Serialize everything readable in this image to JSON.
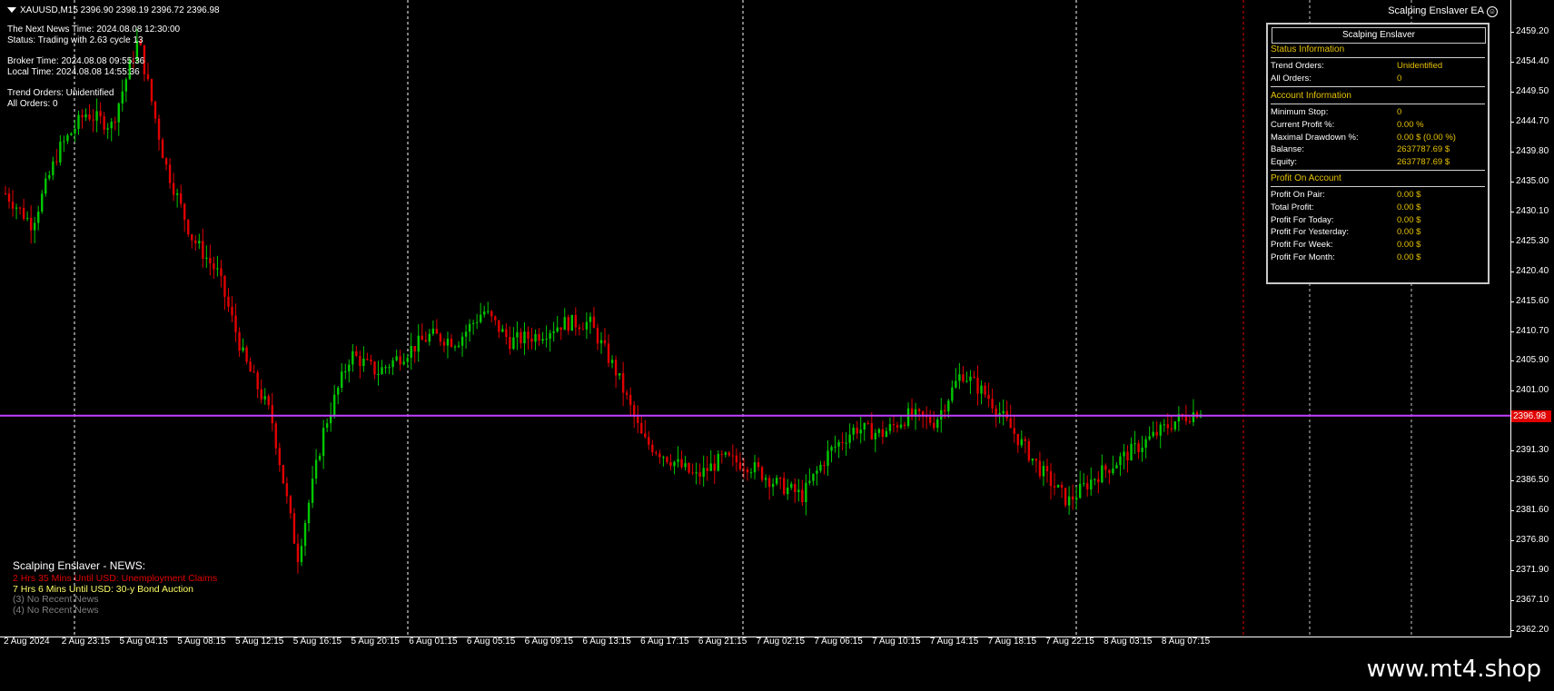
{
  "header": {
    "symbol_line": "XAUUSD,M15  2396.90 2398.19 2396.72 2396.98",
    "ea_label": "Scalping Enslaver EA"
  },
  "info_left": {
    "lines": [
      "The Next News Time: 2024.08.08 12:30:00",
      "Status: Trading with 2.63 cycle 13",
      "",
      "Broker Time: 2024.08.08 09:55:36",
      "Local Time: 2024.08.08 14:55:36",
      "",
      "Trend Orders: Unidentified",
      "All Orders: 0"
    ]
  },
  "panel": {
    "title": "Scalping Enslaver",
    "status_section": "Status Information",
    "status_rows": [
      {
        "label": "Trend Orders:",
        "value": "Unidentified"
      },
      {
        "label": "All Orders:",
        "value": "0"
      }
    ],
    "account_section": "Account Information",
    "account_rows": [
      {
        "label": "Minimum Stop:",
        "value": "0"
      },
      {
        "label": "Current Profit %:",
        "value": "0.00 %"
      },
      {
        "label": "Maximal Drawdown %:",
        "value": "0.00 $ (0.00 %)"
      },
      {
        "label": "Balanse:",
        "value": "2637787.69 $"
      },
      {
        "label": "Equity:",
        "value": "2637787.69 $"
      }
    ],
    "profit_section": "Profit On Account",
    "profit_rows": [
      {
        "label": "Profit On Pair:",
        "value": "0.00 $"
      },
      {
        "label": "Total Profit:",
        "value": "0.00 $"
      },
      {
        "label": "Profit For Today:",
        "value": "0.00 $"
      },
      {
        "label": "Profit For Yesterday:",
        "value": "0.00 $"
      },
      {
        "label": "Profit For Week:",
        "value": "0.00 $"
      },
      {
        "label": "Profit For Month:",
        "value": "0.00 $"
      }
    ]
  },
  "news": {
    "title": "Scalping Enslaver - NEWS:",
    "items": [
      {
        "text": "2 Hrs 35 Mins Until USD: Unemployment Claims",
        "color": "#e00000"
      },
      {
        "text": "7 Hrs 6 Mins Until USD: 30-y Bond Auction",
        "color": "#ffff66"
      },
      {
        "text": "(3)  No Recent News",
        "color": "#808080"
      },
      {
        "text": "(4)  No Recent News",
        "color": "#808080"
      }
    ]
  },
  "price_axis": [
    "2459.20",
    "2454.40",
    "2449.50",
    "2444.70",
    "2439.80",
    "2435.00",
    "2430.10",
    "2425.30",
    "2420.40",
    "2415.60",
    "2410.70",
    "2405.90",
    "2401.00",
    "2396.20",
    "2391.30",
    "2386.50",
    "2381.60",
    "2376.80",
    "2371.90",
    "2367.10",
    "2362.20"
  ],
  "current_price": "2396.98",
  "time_axis": [
    "2 Aug 2024",
    "2 Aug 23:15",
    "5 Aug 04:15",
    "5 Aug 08:15",
    "5 Aug 12:15",
    "5 Aug 16:15",
    "5 Aug 20:15",
    "6 Aug 01:15",
    "6 Aug 05:15",
    "6 Aug 09:15",
    "6 Aug 13:15",
    "6 Aug 17:15",
    "6 Aug 21:15",
    "7 Aug 02:15",
    "7 Aug 06:15",
    "7 Aug 10:15",
    "7 Aug 14:15",
    "7 Aug 18:15",
    "7 Aug 22:15",
    "8 Aug 03:15",
    "8 Aug 07:15"
  ],
  "watermark": "www.mt4.shop",
  "colors": {
    "bull": "#00c800",
    "bear": "#e00000",
    "price_line": "#c040ff",
    "day_separator": "#ffffff",
    "session_separator": "#e00000",
    "accent": "#e6c200"
  },
  "chart_data": {
    "type": "candlestick",
    "ylim": [
      2362.2,
      2461.0
    ],
    "anchor_closes": [
      2433,
      2428,
      2440,
      2446,
      2444,
      2458,
      2438,
      2426,
      2420,
      2406,
      2397,
      2374,
      2395,
      2407,
      2404,
      2407,
      2410,
      2409,
      2414,
      2409,
      2410,
      2412,
      2412,
      2404,
      2393,
      2390,
      2387,
      2390,
      2389,
      2386,
      2384,
      2391,
      2395,
      2394,
      2397,
      2396,
      2404,
      2400,
      2394,
      2388,
      2383,
      2387,
      2390,
      2393,
      2396,
      2398
    ]
  }
}
